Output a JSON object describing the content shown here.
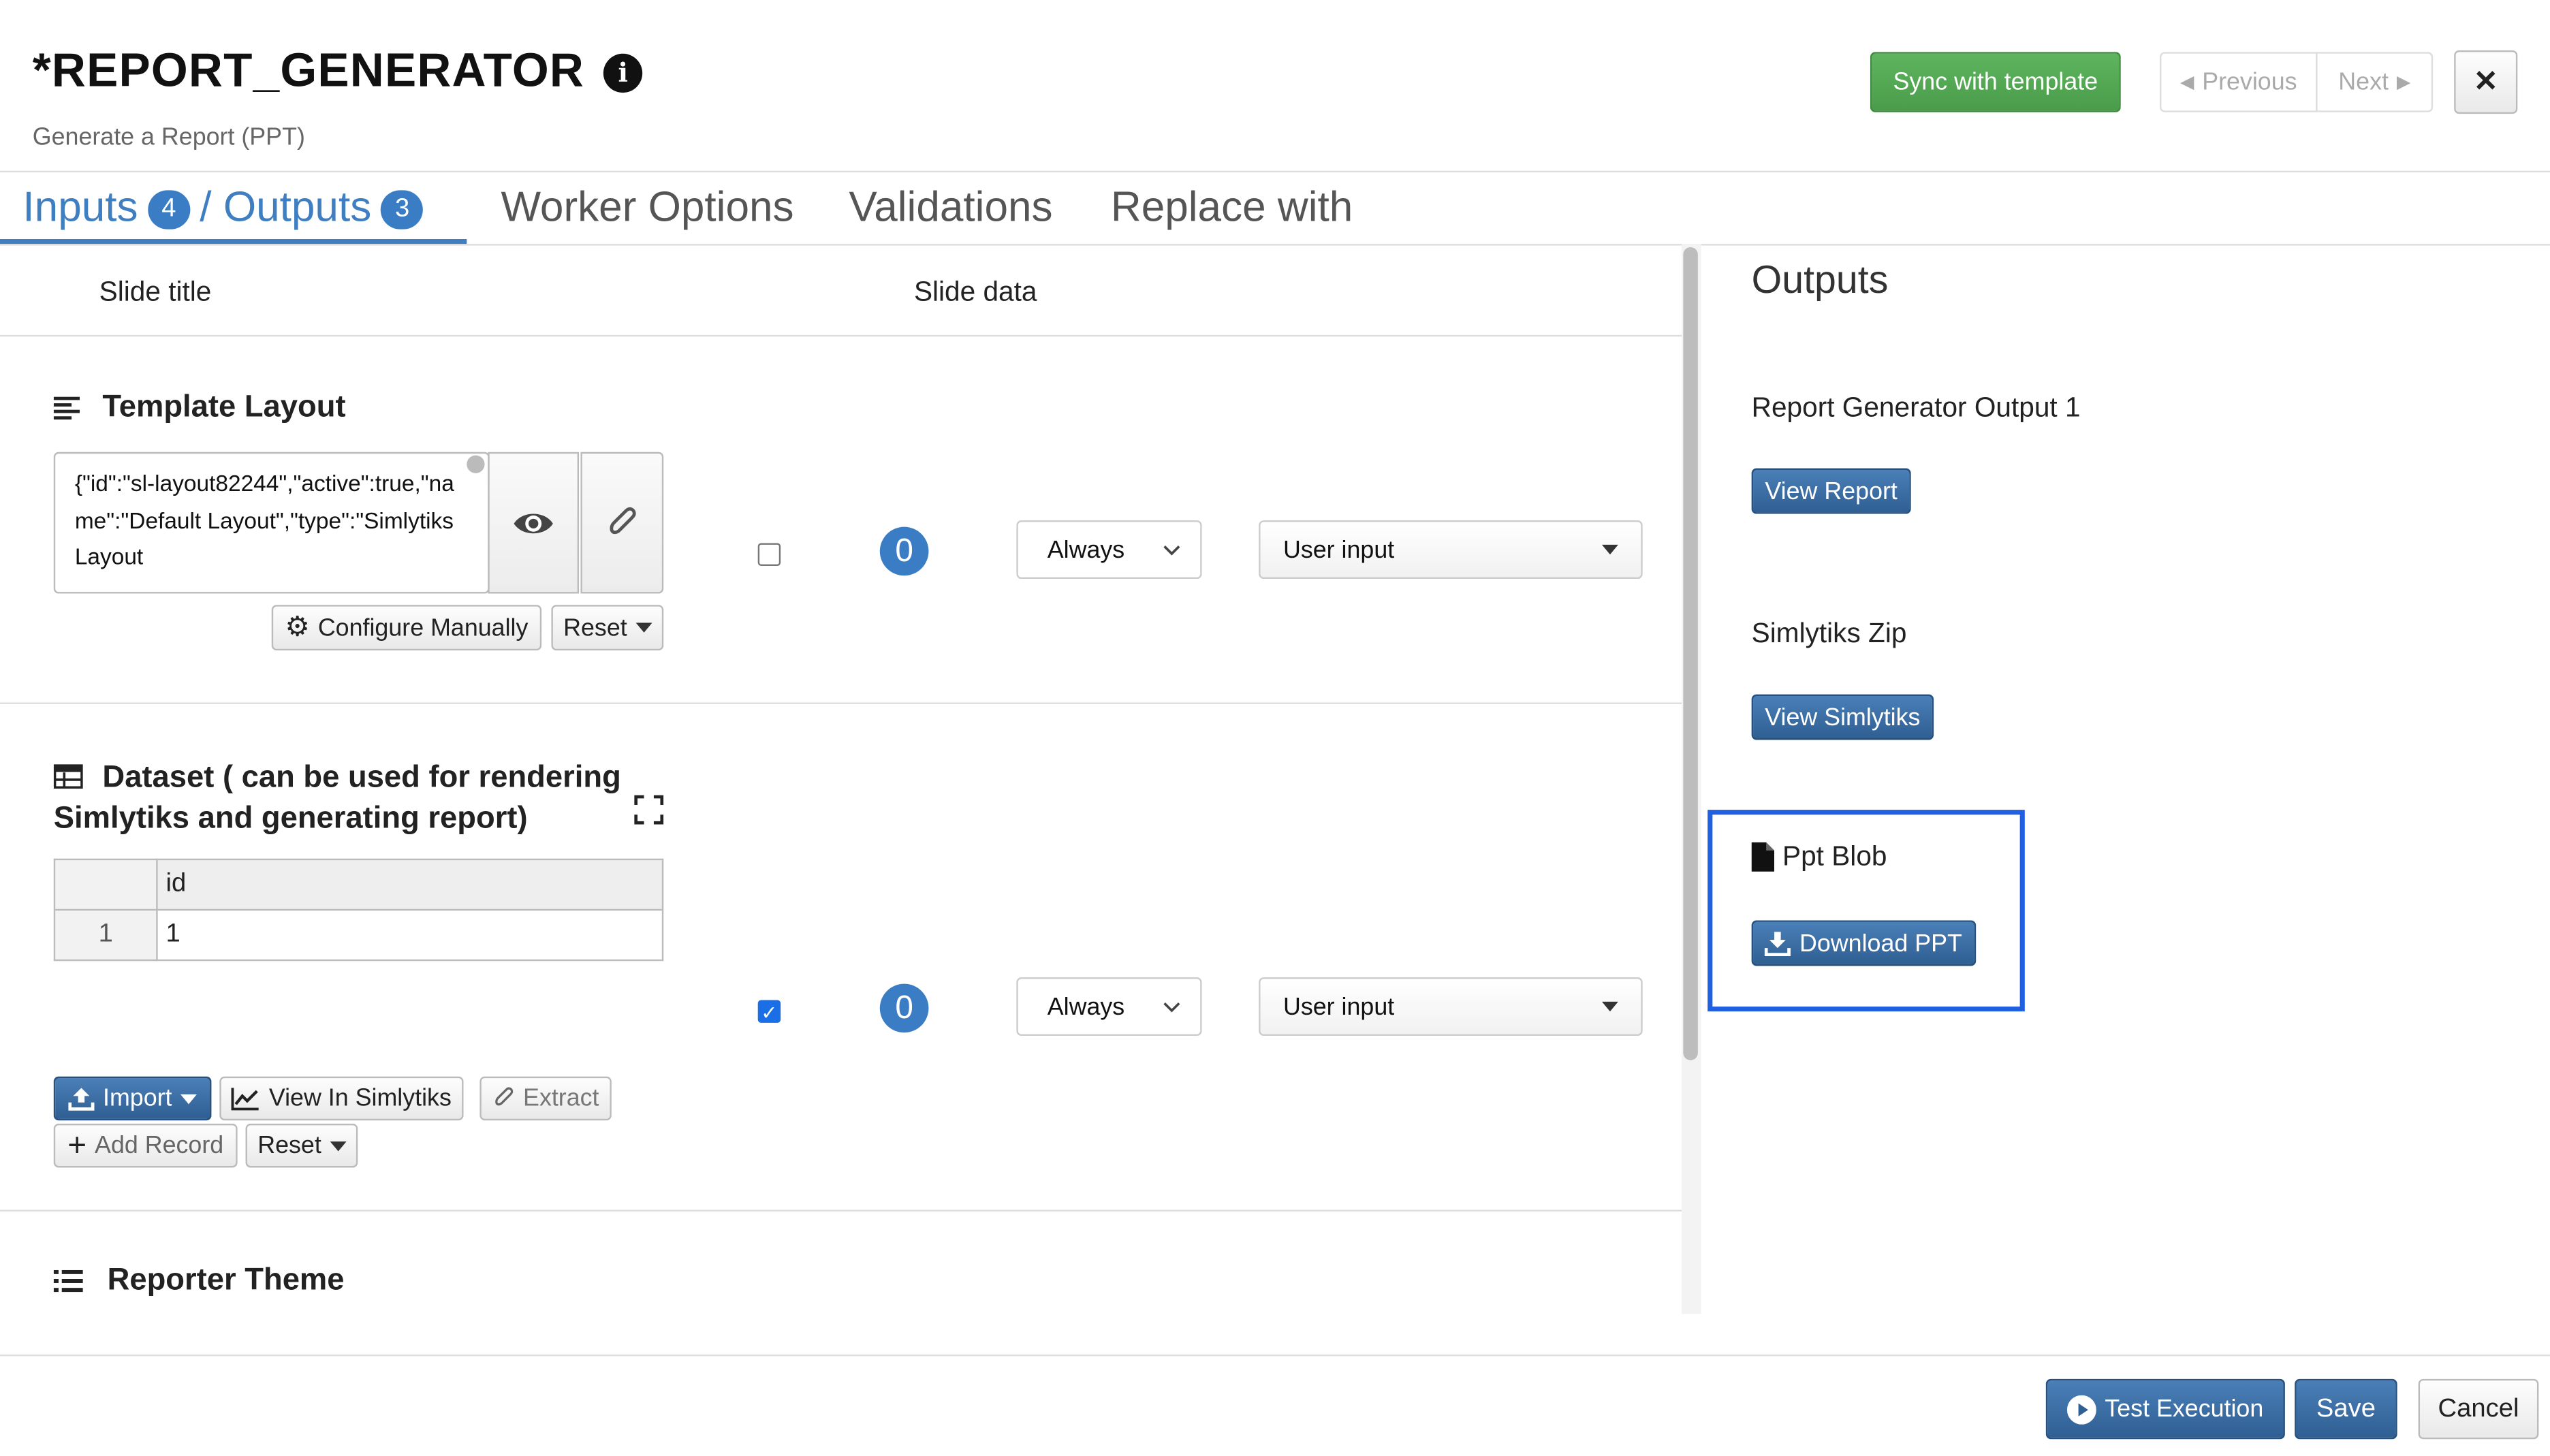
{
  "header": {
    "title": "*REPORT_GENERATOR",
    "subtitle": "Generate a Report (PPT)",
    "sync_label": "Sync with template",
    "previous_label": "Previous",
    "next_label": "Next",
    "close_glyph": "✕"
  },
  "tabs": {
    "inputs_label": "Inputs",
    "inputs_count": "4",
    "separator": "/",
    "outputs_label": "Outputs",
    "outputs_count": "3",
    "worker_options": "Worker Options",
    "validations": "Validations",
    "replace_with": "Replace with"
  },
  "columns": {
    "slide_title": "Slide title",
    "slide_data": "Slide data"
  },
  "template_layout": {
    "title": "Template Layout",
    "value": "{\"id\":\"sl-layout82244\",\"active\":true,\"name\":\"Default Layout\",\"type\":\"Simlytiks Layout",
    "configure_label": "Configure Manually",
    "reset_label": "Reset",
    "checked": false,
    "count": "0",
    "frequency": "Always",
    "source": "User input"
  },
  "dataset": {
    "title": "Dataset ( can be used for rendering Simlytiks and generating report)",
    "column_header": "id",
    "rows": [
      {
        "index": "1",
        "id": "1"
      }
    ],
    "checked": true,
    "count": "0",
    "frequency": "Always",
    "source": "User input",
    "import_label": "Import",
    "view_label": "View In Simlytiks",
    "extract_label": "Extract",
    "add_record_label": "Add Record",
    "reset_label": "Reset"
  },
  "reporter_theme": {
    "title": "Reporter Theme"
  },
  "outputs": {
    "heading": "Outputs",
    "items": [
      {
        "label": "Report Generator Output 1",
        "button": "View Report"
      },
      {
        "label": "Simlytiks Zip",
        "button": "View Simlytiks"
      },
      {
        "label": "Ppt Blob",
        "button": "Download PPT"
      }
    ]
  },
  "footer": {
    "test_label": "Test Execution",
    "save_label": "Save",
    "cancel_label": "Cancel"
  },
  "colors": {
    "primary": "#3a6ea5",
    "green": "#4a9c4a",
    "tab_active": "#3f7fc1",
    "highlight": "#1f5fe0"
  }
}
